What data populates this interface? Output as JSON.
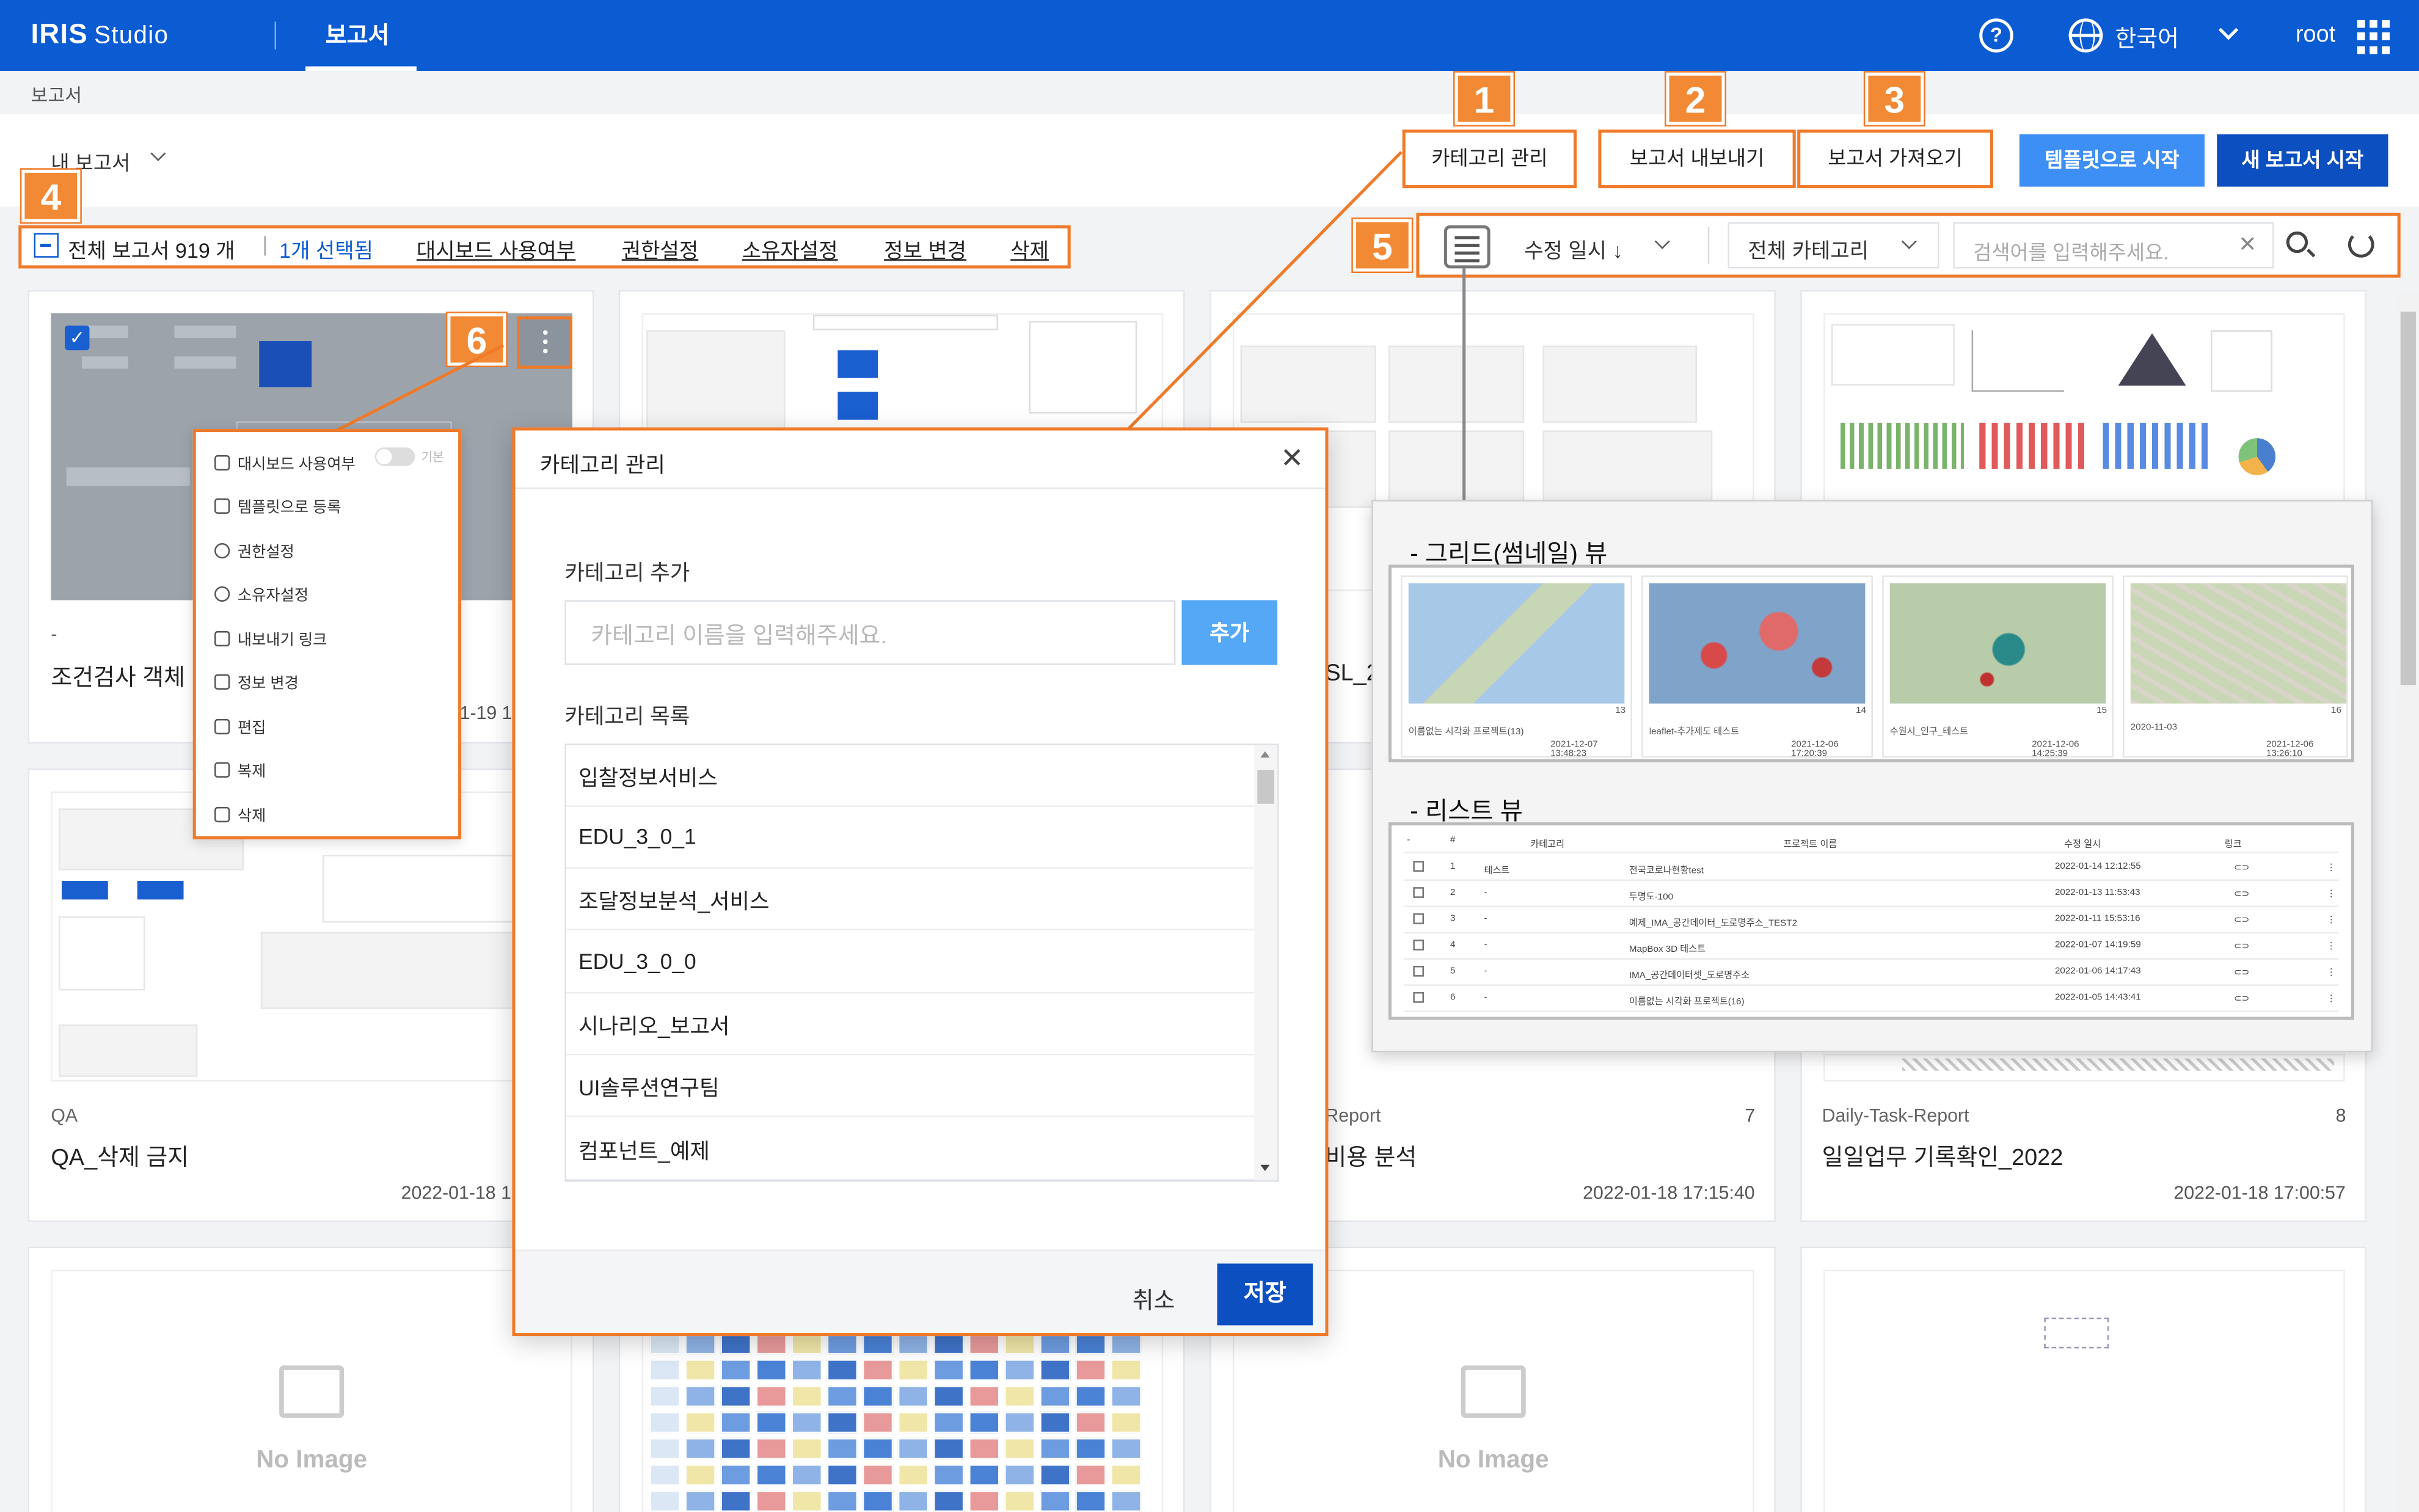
{
  "app": {
    "logo": "IRIS",
    "logo_suffix": "Studio",
    "nav_tab": "보고서",
    "help": "?",
    "language": "한국어",
    "user": "root"
  },
  "breadcrumb": "보고서",
  "header": {
    "my_reports": "내 보고서",
    "btn_category": "카테고리 관리",
    "btn_export": "보고서 내보내기",
    "btn_import": "보고서 가져오기",
    "btn_template": "템플릿으로 시작",
    "btn_new": "새 보고서 시작"
  },
  "markers": [
    "1",
    "2",
    "3",
    "4",
    "5",
    "6"
  ],
  "toolbar": {
    "total": "전체 보고서 919 개",
    "selected": "1개 선택됨",
    "dashboard_use": "대시보드 사용여부",
    "permission": "권한설정",
    "owner": "소유자설정",
    "info_change": "정보 변경",
    "delete": "삭제",
    "sort": "수정 일시 ↓",
    "category": "전체 카테고리",
    "search_placeholder": "검색어를 입력해주세요."
  },
  "context_menu": {
    "items": [
      "대시보드 사용여부",
      "템플릿으로 등록",
      "권한설정",
      "소유자설정",
      "내보내기 링크",
      "정보 변경",
      "편집",
      "복제",
      "삭제"
    ],
    "toggle_label": "기본"
  },
  "modal": {
    "title": "카테고리 관리",
    "add_label": "카테고리 추가",
    "input_placeholder": "카테고리 이름을 입력해주세요.",
    "add_button": "추가",
    "list_label": "카테고리 목록",
    "items": [
      "입찰정보서비스",
      "EDU_3_0_1",
      "조달정보분석_서비스",
      "EDU_3_0_0",
      "시나리오_보고서",
      "UI솔루션연구팀",
      "컴포넌트_예제"
    ],
    "cancel": "취소",
    "save": "저장"
  },
  "cards": [
    {
      "tag": "-",
      "title": "조건검사 객체",
      "date_fragment": "1-19 1"
    },
    {
      "title_fragment": "SL_2"
    },
    {
      "tag": "QA",
      "title": "QA_삭제 금지",
      "date": "2022-01-18 1"
    },
    {
      "tag_fragment": "Report",
      "title_fragment": "비용 분석",
      "num": "7",
      "date": "2022-01-18 17:15:40"
    },
    {
      "tag": "Daily-Task-Report",
      "title": "일일업무 기록확인_2022",
      "num": "8",
      "date": "2022-01-18 17:00:57"
    }
  ],
  "no_image": "No Image",
  "preview": {
    "grid_label": "- 그리드(썸네일) 뷰",
    "list_label": "- 리스트 뷰",
    "grid_items": [
      {
        "name": "이름없는 시각화 프로젝트(13)",
        "num": "13",
        "date": "2021-12-07 13:48:23"
      },
      {
        "name": "leaflet-추가제도 테스트",
        "num": "14",
        "date": "2021-12-06 17:20:39"
      },
      {
        "name": "수원시_인구_테스트",
        "num": "15",
        "date": "2021-12-06 14:25:39"
      },
      {
        "name": "2020-11-03",
        "num": "16",
        "date": "2021-12-06 13:26:10"
      }
    ],
    "list_headers": [
      "#",
      "카테고리",
      "프로젝트 이름",
      "수정 일시",
      "링크"
    ],
    "list_rows": [
      {
        "n": "1",
        "cat": "테스트",
        "name": "전국코로나현황test",
        "date": "2022-01-14 12:12:55"
      },
      {
        "n": "2",
        "cat": "-",
        "name": "투명도-100",
        "date": "2022-01-13 11:53:43"
      },
      {
        "n": "3",
        "cat": "-",
        "name": "예제_IMA_공간데이터_도로명주소_TEST2",
        "date": "2022-01-11 15:53:16"
      },
      {
        "n": "4",
        "cat": "-",
        "name": "MapBox 3D 테스트",
        "date": "2022-01-07 14:19:59"
      },
      {
        "n": "5",
        "cat": "-",
        "name": "IMA_공간데이터셋_도로명주소",
        "date": "2022-01-06 14:17:43"
      },
      {
        "n": "6",
        "cat": "-",
        "name": "이름없는 시각화 프로젝트(16)",
        "date": "2022-01-05 14:43:41"
      }
    ]
  },
  "colors": {
    "brand": "#0b5bd3",
    "highlight": "#ef7a2a",
    "accent": "#3d8ef5"
  }
}
